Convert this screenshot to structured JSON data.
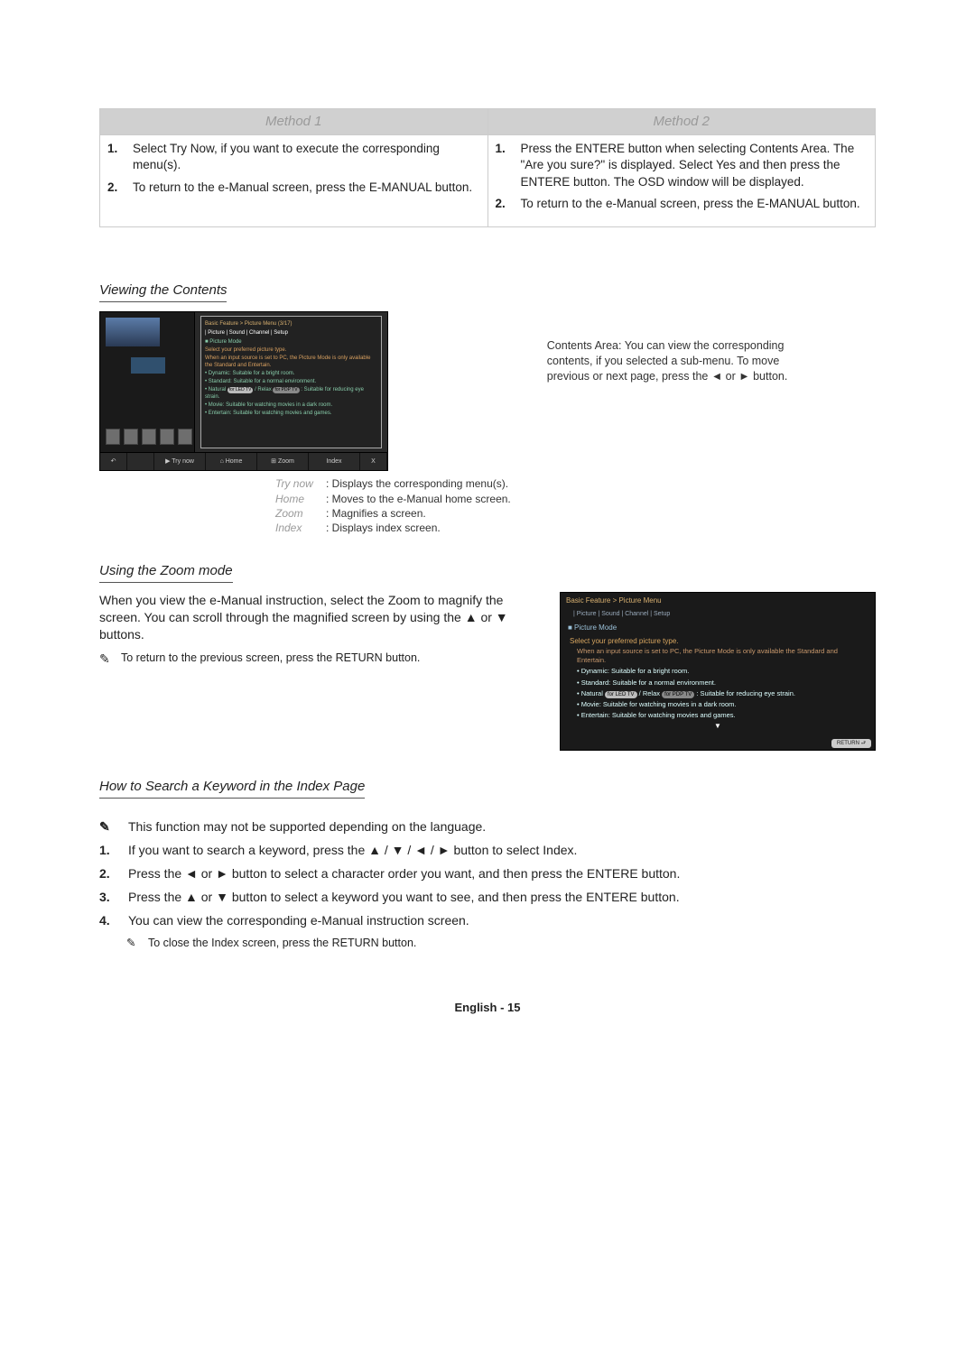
{
  "methods": {
    "header1": "Method 1",
    "header2": "Method 2",
    "m1_step1_num": "1.",
    "m1_step1": "Select Try Now, if you want to execute the corresponding menu(s).",
    "m1_step2_num": "2.",
    "m1_step2": "To return to the e-Manual screen, press the E-MANUAL button.",
    "m2_step1_num": "1.",
    "m2_step1": "Press the ENTERE button when selecting Contents Area. The \"Are you sure?\" is displayed. Select Yes and then press the ENTERE button. The OSD window will be displayed.",
    "m2_step2_num": "2.",
    "m2_step2": "To return to the e-Manual screen, press the E-MANUAL button."
  },
  "sections": {
    "viewing": "Viewing the Contents",
    "zoom": "Using the Zoom mode",
    "search": "How to Search a Keyword in the Index Page"
  },
  "shot1": {
    "breadcrumb": "Basic Feature > Picture Menu (3/17)",
    "tabs": "| Picture   | Sound | Channel | Setup",
    "mode": "■ Picture Mode",
    "desc": "Select your preferred picture type.",
    "cond": "When an input source is set to PC, the Picture Mode is only available the Standard and Entertain.",
    "b1": "• Dynamic: Suitable for a bright room.",
    "b2": "• Standard: Suitable for a normal environment.",
    "b3a": "• Natural",
    "b3b": " / Relax",
    "b3c": ": Suitable for reducing eye strain.",
    "b4": "• Movie: Suitable for watching movies in a dark room.",
    "b5": "• Entertain: Suitable for watching movies and games.",
    "btn_try": "▶ Try now",
    "btn_home": "⌂ Home",
    "btn_zoom": "⊞ Zoom",
    "btn_index": "Index",
    "btn_close": "X",
    "btn_back": "↶",
    "led_badge": "for LED TV",
    "pdp_badge": "for PDP TV"
  },
  "contents_desc": "Contents Area: You can view the corresponding contents, if you selected a sub-menu. To move previous or next page, press the ◄ or ► button.",
  "legend": {
    "trynow_k": "Try now",
    "trynow_v": ": Displays the corresponding menu(s).",
    "home_k": "Home",
    "home_v": ": Moves to the e-Manual home screen.",
    "zoom_k": "Zoom",
    "zoom_v": ": Magnifies a screen.",
    "index_k": "Index",
    "index_v": ": Displays index screen."
  },
  "zoom_text": {
    "para": "When you view the e-Manual instruction, select the Zoom to magnify the screen. You can scroll through the magnified screen by using the ▲ or ▼ buttons.",
    "note": "To return to the previous screen, press the RETURN button."
  },
  "shot2": {
    "title": "Basic Feature > Picture Menu",
    "tabs": "| Picture   | Sound | Channel | Setup",
    "mode": "■ Picture Mode",
    "desc": "Select your preferred picture type.",
    "cond": "When an input source is set to PC, the Picture Mode is only available the Standard and Entertain.",
    "b1": "• Dynamic: Suitable for a bright room.",
    "b2": "• Standard: Suitable for a normal environment.",
    "b3a": "• Natural",
    "b3b": " / Relax",
    "b3c": ": Suitable for reducing eye strain.",
    "b4": "• Movie: Suitable for watching movies in a dark room.",
    "b5": "• Entertain: Suitable for watching movies and games.",
    "return": "RETURN ⮐"
  },
  "search": {
    "note_b": "✎",
    "note": "This function may not be supported depending on the language.",
    "s1_num": "1.",
    "s1": "If you want to search a keyword, press the ▲ / ▼ / ◄ / ► button to select Index.",
    "s2_num": "2.",
    "s2": "Press the ◄ or ► button to select a character order you want, and then press the ENTERE button.",
    "s3_num": "3.",
    "s3": "Press the ▲ or ▼ button to select a keyword you want to see, and then press the ENTERE button.",
    "s4_num": "4.",
    "s4": "You can view the corresponding e-Manual instruction screen.",
    "close_b": "✎",
    "close": "To close the Index screen, press the RETURN button."
  },
  "footer": "English - 15"
}
